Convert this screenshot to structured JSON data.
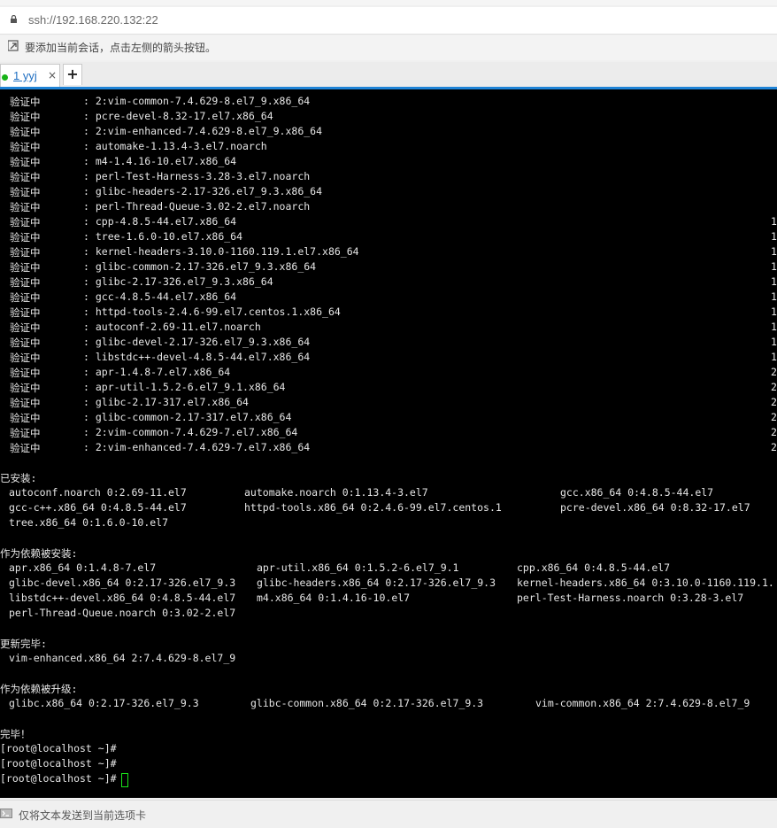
{
  "address": "ssh://192.168.220.132:22",
  "hint": "要添加当前会话，点击左侧的箭头按钮。",
  "tab": {
    "label": "1 yyj",
    "close": "×",
    "new": "+"
  },
  "terminal": {
    "verify": [
      {
        "status": "验证中",
        "pkg": ": 2:vim-common-7.4.629-8.el7_9.x86_64",
        "num": ""
      },
      {
        "status": "验证中",
        "pkg": ": pcre-devel-8.32-17.el7.x86_64",
        "num": ""
      },
      {
        "status": "验证中",
        "pkg": ": 2:vim-enhanced-7.4.629-8.el7_9.x86_64",
        "num": ""
      },
      {
        "status": "验证中",
        "pkg": ": automake-1.13.4-3.el7.noarch",
        "num": ""
      },
      {
        "status": "验证中",
        "pkg": ": m4-1.4.16-10.el7.x86_64",
        "num": ""
      },
      {
        "status": "验证中",
        "pkg": ": perl-Test-Harness-3.28-3.el7.noarch",
        "num": ""
      },
      {
        "status": "验证中",
        "pkg": ": glibc-headers-2.17-326.el7_9.3.x86_64",
        "num": ""
      },
      {
        "status": "验证中",
        "pkg": ": perl-Thread-Queue-3.02-2.el7.noarch",
        "num": ""
      },
      {
        "status": "验证中",
        "pkg": ": cpp-4.8.5-44.el7.x86_64",
        "num": "1"
      },
      {
        "status": "验证中",
        "pkg": ": tree-1.6.0-10.el7.x86_64",
        "num": "1"
      },
      {
        "status": "验证中",
        "pkg": ": kernel-headers-3.10.0-1160.119.1.el7.x86_64",
        "num": "1"
      },
      {
        "status": "验证中",
        "pkg": ": glibc-common-2.17-326.el7_9.3.x86_64",
        "num": "1"
      },
      {
        "status": "验证中",
        "pkg": ": glibc-2.17-326.el7_9.3.x86_64",
        "num": "1"
      },
      {
        "status": "验证中",
        "pkg": ": gcc-4.8.5-44.el7.x86_64",
        "num": "1"
      },
      {
        "status": "验证中",
        "pkg": ": httpd-tools-2.4.6-99.el7.centos.1.x86_64",
        "num": "1"
      },
      {
        "status": "验证中",
        "pkg": ": autoconf-2.69-11.el7.noarch",
        "num": "1"
      },
      {
        "status": "验证中",
        "pkg": ": glibc-devel-2.17-326.el7_9.3.x86_64",
        "num": "1"
      },
      {
        "status": "验证中",
        "pkg": ": libstdc++-devel-4.8.5-44.el7.x86_64",
        "num": "1"
      },
      {
        "status": "验证中",
        "pkg": ": apr-1.4.8-7.el7.x86_64",
        "num": "2"
      },
      {
        "status": "验证中",
        "pkg": ": apr-util-1.5.2-6.el7_9.1.x86_64",
        "num": "2"
      },
      {
        "status": "验证中",
        "pkg": ": glibc-2.17-317.el7.x86_64",
        "num": "2"
      },
      {
        "status": "验证中",
        "pkg": ": glibc-common-2.17-317.el7.x86_64",
        "num": "2"
      },
      {
        "status": "验证中",
        "pkg": ": 2:vim-common-7.4.629-7.el7.x86_64",
        "num": "2"
      },
      {
        "status": "验证中",
        "pkg": ": 2:vim-enhanced-7.4.629-7.el7.x86_64",
        "num": "2"
      }
    ],
    "installed": {
      "header": "已安装:",
      "rows": [
        [
          "autoconf.noarch 0:2.69-11.el7",
          "automake.noarch 0:1.13.4-3.el7",
          "gcc.x86_64 0:4.8.5-44.el7"
        ],
        [
          "gcc-c++.x86_64 0:4.8.5-44.el7",
          "httpd-tools.x86_64 0:2.4.6-99.el7.centos.1",
          "pcre-devel.x86_64 0:8.32-17.el7"
        ],
        [
          "tree.x86_64 0:1.6.0-10.el7",
          "",
          ""
        ]
      ]
    },
    "dep_installed": {
      "header": "作为依赖被安装:",
      "rows": [
        [
          "apr.x86_64 0:1.4.8-7.el7",
          "apr-util.x86_64 0:1.5.2-6.el7_9.1",
          "cpp.x86_64 0:4.8.5-44.el7"
        ],
        [
          "glibc-devel.x86_64 0:2.17-326.el7_9.3",
          "glibc-headers.x86_64 0:2.17-326.el7_9.3",
          "kernel-headers.x86_64 0:3.10.0-1160.119.1."
        ],
        [
          "libstdc++-devel.x86_64 0:4.8.5-44.el7",
          "m4.x86_64 0:1.4.16-10.el7",
          "perl-Test-Harness.noarch 0:3.28-3.el7"
        ],
        [
          "perl-Thread-Queue.noarch 0:3.02-2.el7",
          "",
          ""
        ]
      ]
    },
    "updated": {
      "header": "更新完毕:",
      "row": "vim-enhanced.x86_64 2:7.4.629-8.el7_9"
    },
    "dep_updated": {
      "header": "作为依赖被升级:",
      "row": [
        "glibc.x86_64 0:2.17-326.el7_9.3",
        "glibc-common.x86_64 0:2.17-326.el7_9.3",
        "vim-common.x86_64 2:7.4.629-8.el7_9"
      ]
    },
    "done": "完毕！",
    "prompts": [
      "[root@localhost ~]#",
      "[root@localhost ~]#",
      "[root@localhost ~]#"
    ]
  },
  "status_text": "仅将文本发送到当前选项卡"
}
